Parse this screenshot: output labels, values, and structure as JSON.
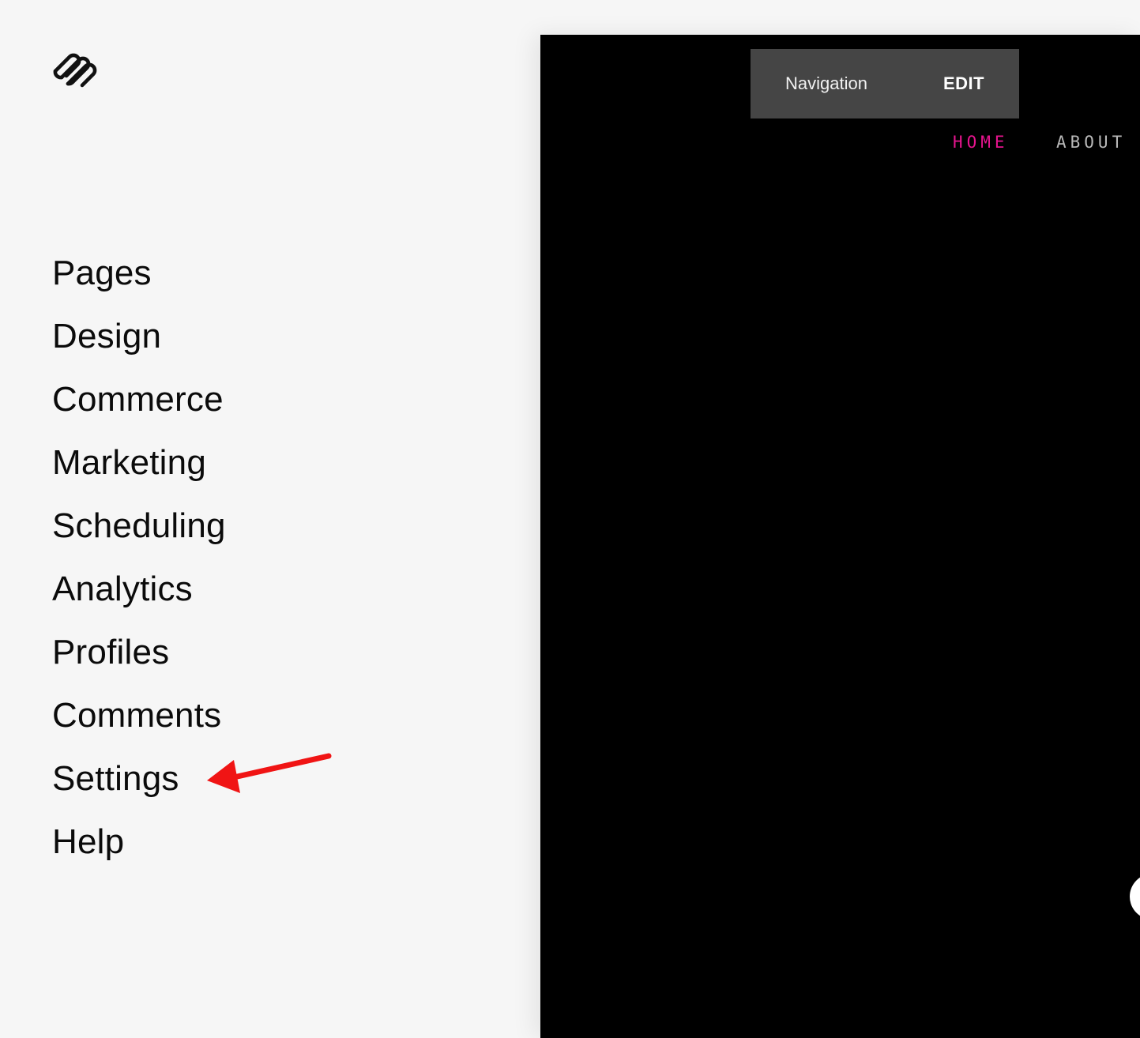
{
  "sidebar": {
    "logo_icon": "squarespace-logo-icon",
    "items": [
      {
        "label": "Pages"
      },
      {
        "label": "Design"
      },
      {
        "label": "Commerce"
      },
      {
        "label": "Marketing"
      },
      {
        "label": "Scheduling"
      },
      {
        "label": "Analytics"
      },
      {
        "label": "Profiles"
      },
      {
        "label": "Comments"
      },
      {
        "label": "Settings"
      },
      {
        "label": "Help"
      }
    ]
  },
  "annotation": {
    "arrow_icon": "red-arrow-icon",
    "color": "#f01414"
  },
  "preview": {
    "edit_bar": {
      "label": "Navigation",
      "edit_label": "EDIT"
    },
    "site_nav": {
      "links": [
        {
          "label": "HOME"
        },
        {
          "label": "ABOUT"
        }
      ],
      "active_color": "#e6148e",
      "inactive_color": "#b9b9b9"
    }
  }
}
